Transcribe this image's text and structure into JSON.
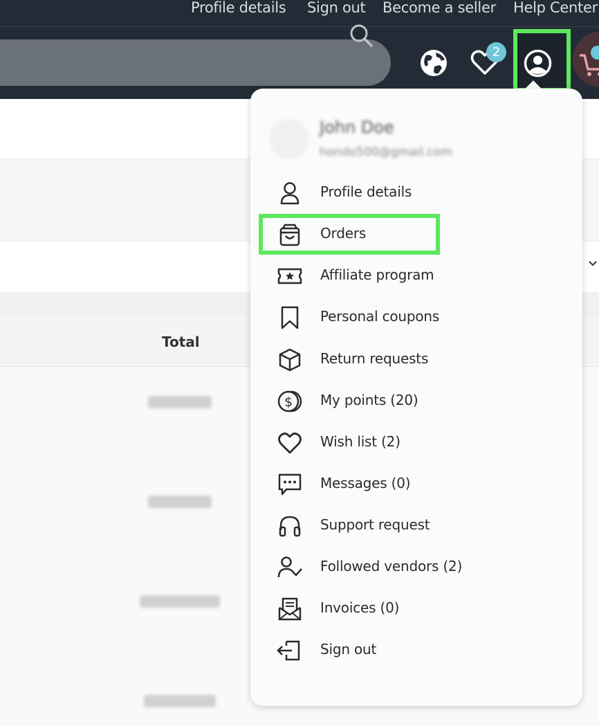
{
  "topnav": {
    "links": [
      "Profile details",
      "Sign out",
      "Become a seller",
      "Help Center"
    ]
  },
  "header": {
    "search_icon": "search-icon",
    "icons": [
      "globe-icon",
      "heart-icon",
      "user-circle-icon",
      "cart-icon"
    ],
    "wishlist_badge": "2"
  },
  "table": {
    "total_header": "Total"
  },
  "dropdown": {
    "user_name": "John Doe",
    "user_email": "hondo500@gmail.com",
    "items": [
      {
        "label": "Profile details",
        "icon": "user-icon"
      },
      {
        "label": "Orders",
        "icon": "shopping-bag-icon"
      },
      {
        "label": "Affiliate program",
        "icon": "ticket-star-icon"
      },
      {
        "label": "Personal coupons",
        "icon": "bookmark-icon"
      },
      {
        "label": "Return requests",
        "icon": "box-icon"
      },
      {
        "label": "My points (20)",
        "icon": "coins-icon"
      },
      {
        "label": "Wish list (2)",
        "icon": "heart-icon"
      },
      {
        "label": "Messages (0)",
        "icon": "chat-icon"
      },
      {
        "label": "Support request",
        "icon": "headphones-icon"
      },
      {
        "label": "Followed vendors (2)",
        "icon": "user-check-icon"
      },
      {
        "label": "Invoices (0)",
        "icon": "invoice-envelope-icon"
      },
      {
        "label": "Sign out",
        "icon": "sign-out-icon"
      }
    ]
  },
  "colors": {
    "header_bg": "#232c36",
    "highlight": "#5ee85e",
    "badge": "#6fc7d9"
  }
}
